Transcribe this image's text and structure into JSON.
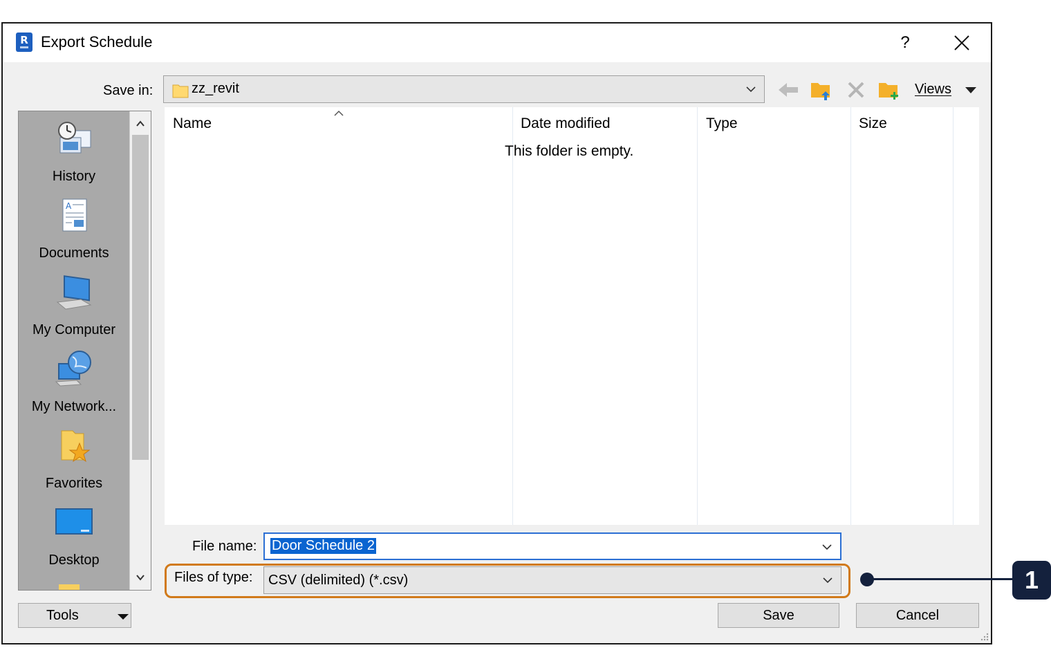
{
  "window": {
    "title": "Export Schedule",
    "help_glyph": "?",
    "close_label": "Close"
  },
  "save_in": {
    "label": "Save in:",
    "value": "zz_revit"
  },
  "toolbar": {
    "views_label": "Views"
  },
  "places": [
    {
      "label": "History",
      "icon": "history-icon"
    },
    {
      "label": "Documents",
      "icon": "documents-icon"
    },
    {
      "label": "My Computer",
      "icon": "my-computer-icon"
    },
    {
      "label": "My Network...",
      "icon": "my-network-icon"
    },
    {
      "label": "Favorites",
      "icon": "favorites-icon"
    },
    {
      "label": "Desktop",
      "icon": "desktop-icon"
    }
  ],
  "file_list": {
    "columns": [
      "Name",
      "Date modified",
      "Type",
      "Size"
    ],
    "empty_message": "This folder is empty."
  },
  "file_name": {
    "label": "File name:",
    "value": "Door Schedule 2"
  },
  "files_of_type": {
    "label": "Files of type:",
    "value": "CSV (delimited) (*.csv)"
  },
  "buttons": {
    "tools": "Tools",
    "save": "Save",
    "cancel": "Cancel"
  },
  "callout": {
    "number": "1"
  },
  "colors": {
    "highlight": "#d17a1a",
    "callout": "#14213d",
    "selection": "#0a64d0"
  }
}
